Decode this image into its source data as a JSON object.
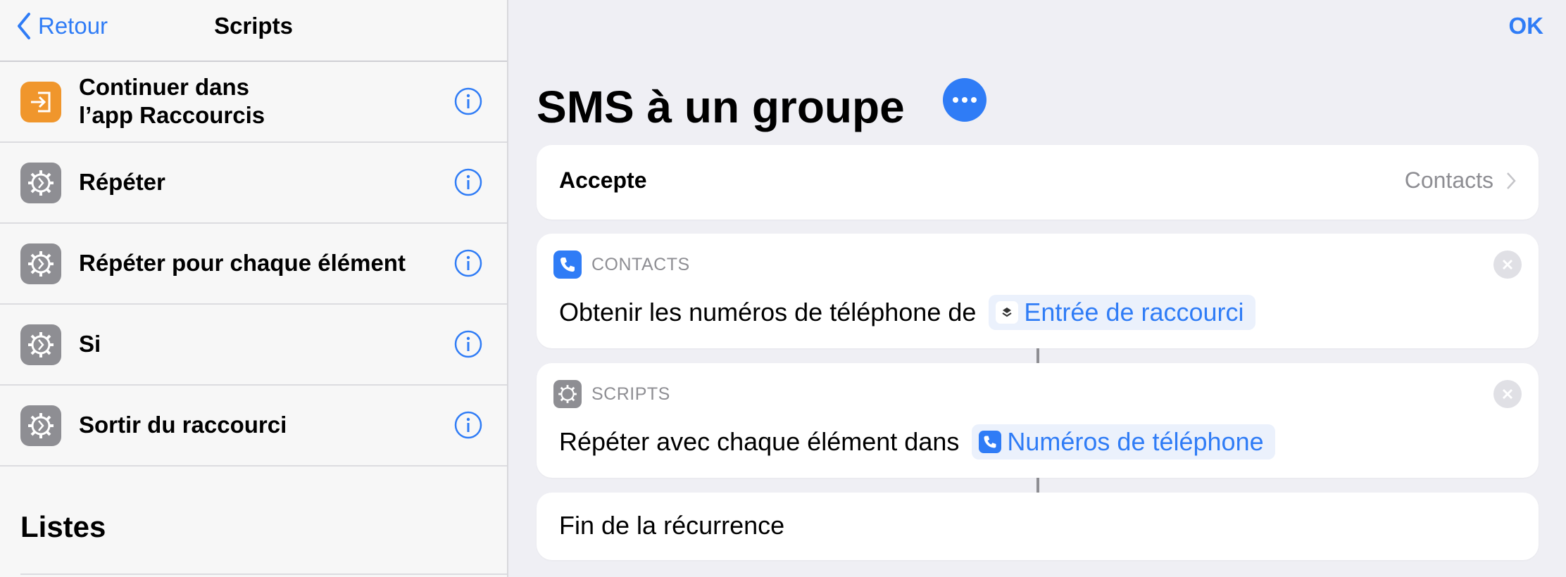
{
  "sidebar": {
    "back_label": "Retour",
    "title": "Scripts",
    "items": [
      {
        "label": "Continuer dans\nl’app Raccourcis",
        "icon": "enter-app-icon",
        "icon_color": "#f0962c"
      },
      {
        "label": "Répéter",
        "icon": "gear-icon",
        "icon_color": "#8e8e93"
      },
      {
        "label": "Répéter pour chaque élément",
        "icon": "gear-icon",
        "icon_color": "#8e8e93"
      },
      {
        "label": "Si",
        "icon": "gear-icon",
        "icon_color": "#8e8e93"
      },
      {
        "label": "Sortir du raccourci",
        "icon": "gear-icon",
        "icon_color": "#8e8e93"
      }
    ],
    "section_heading": "Listes"
  },
  "main": {
    "done_label": "OK",
    "shortcut_title": "SMS à un groupe",
    "accepts": {
      "label": "Accepte",
      "value": "Contacts"
    },
    "actions": [
      {
        "category": "CONTACTS",
        "category_icon": "phone-icon",
        "text": "Obtenir les numéros de téléphone de",
        "token": {
          "label": "Entrée de raccourci",
          "icon": "shortcuts-icon"
        }
      },
      {
        "category": "SCRIPTS",
        "category_icon": "gear-icon",
        "text": "Répéter avec chaque élément dans",
        "token": {
          "label": "Numéros de téléphone",
          "icon": "phone-icon"
        }
      }
    ],
    "end_label": "Fin de la récurrence"
  },
  "colors": {
    "accent": "#2f7cf6",
    "orange": "#f0962c",
    "gray_icon": "#8e8e93",
    "background": "#efeff4"
  }
}
